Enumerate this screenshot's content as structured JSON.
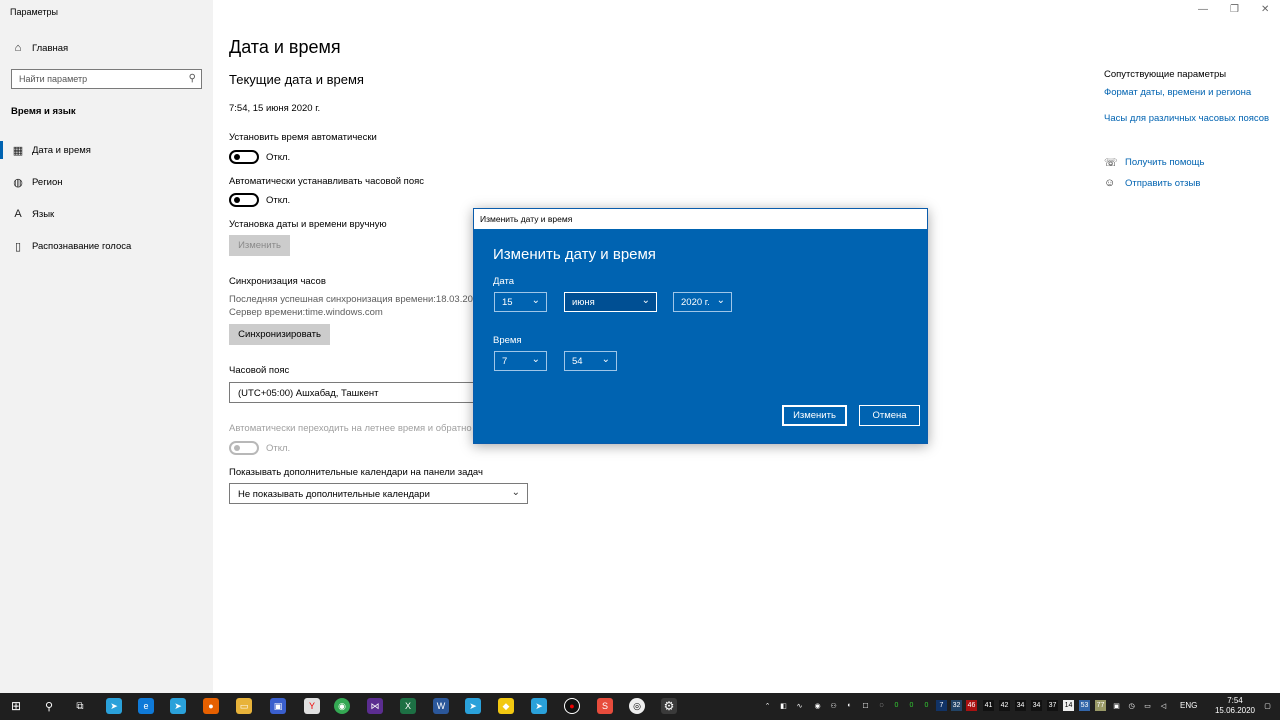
{
  "window": {
    "title": "Параметры",
    "controls": [
      "—",
      "❐",
      "✕"
    ]
  },
  "sidebar": {
    "home": "Главная",
    "search_placeholder": "Найти параметр",
    "section": "Время и язык",
    "items": [
      {
        "label": "Дата и время",
        "icon": "calendar-clock-icon",
        "active": true
      },
      {
        "label": "Регион",
        "icon": "globe-icon"
      },
      {
        "label": "Язык",
        "icon": "language-icon"
      },
      {
        "label": "Распознавание голоса",
        "icon": "microphone-icon"
      }
    ]
  },
  "main": {
    "title": "Дата и время",
    "subtitle": "Текущие дата и время",
    "current": "7:54, 15 июня 2020 г.",
    "auto_time_label": "Установить время автоматически",
    "auto_time_state": "Откл.",
    "auto_tz_label": "Автоматически устанавливать часовой пояс",
    "auto_tz_state": "Откл.",
    "manual_label": "Установка даты и времени вручную",
    "change_button": "Изменить",
    "sync_header": "Синхронизация часов",
    "sync_last": "Последняя успешная синхронизация времени:18.03.2020",
    "sync_server": "Сервер времени:time.windows.com",
    "sync_button": "Синхронизировать",
    "tz_label": "Часовой пояс",
    "tz_value": "(UTC+05:00) Ашхабад, Ташкент",
    "dst_label": "Автоматически переходить на летнее время и обратно",
    "dst_state": "Откл.",
    "calendars_label": "Показывать дополнительные календари на панели задач",
    "calendars_value": "Не показывать дополнительные календари"
  },
  "related": {
    "header": "Сопутствующие параметры",
    "link1": "Формат даты, времени и региона",
    "link2": "Часы для различных часовых поясов",
    "help": "Получить помощь",
    "feedback": "Отправить отзыв"
  },
  "dialog": {
    "window_title": "Изменить дату и время",
    "heading": "Изменить дату и время",
    "date_label": "Дата",
    "day": "15",
    "month": "июня",
    "year": "2020 г.",
    "time_label": "Время",
    "hour": "7",
    "minute": "54",
    "ok": "Изменить",
    "cancel": "Отмена"
  },
  "taskbar": {
    "lang": "ENG",
    "time": "7:54",
    "date": "15.06.2020",
    "tray_numbers": [
      "0",
      "0",
      "0",
      "7",
      "32",
      "46",
      "41",
      "42",
      "34",
      "34",
      "37",
      "14",
      "53",
      "77"
    ]
  },
  "colors": {
    "accent": "#0063b1",
    "sidebar": "#f2f2f2",
    "taskbar": "#1f1f1f"
  }
}
